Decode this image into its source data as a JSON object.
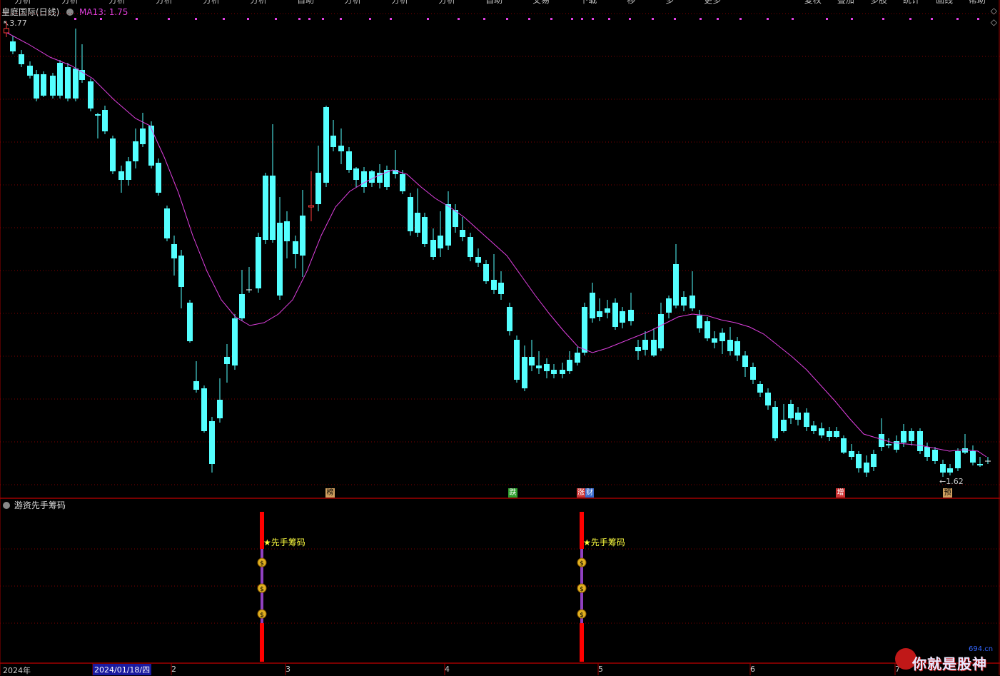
{
  "window": {
    "title": "皇庭国际(日线)",
    "ma_label": "MA13: 1.75",
    "high_label": "3.77",
    "low_label": "1.62",
    "indicator_title": "游资先手筹码"
  },
  "top_menu": [
    {
      "label": "分析"
    },
    {
      "label": "分析"
    },
    {
      "label": "分析"
    },
    {
      "label": "分析"
    },
    {
      "label": "分析"
    },
    {
      "label": "分析"
    },
    {
      "label": "自助"
    },
    {
      "label": "分析"
    },
    {
      "label": "分析"
    },
    {
      "label": "分析"
    },
    {
      "label": "自助"
    },
    {
      "label": "交易"
    },
    {
      "label": "下载"
    },
    {
      "label": "移"
    },
    {
      "label": "多"
    },
    {
      "label": "更多"
    }
  ],
  "top_buttons": [
    {
      "label": "复权"
    },
    {
      "label": "叠加"
    },
    {
      "label": "多股"
    },
    {
      "label": "统计"
    },
    {
      "label": "画线"
    },
    {
      "label": "帮助"
    }
  ],
  "events": [
    {
      "label": "榜",
      "color": "#cfa060"
    },
    {
      "label": "跌",
      "color": "#2fa02f"
    },
    {
      "label": "涨",
      "color": "#cc3333"
    },
    {
      "label": "财",
      "color": "#3366cc"
    },
    {
      "label": "增",
      "color": "#cc3333"
    },
    {
      "label": "预",
      "color": "#cfa060"
    }
  ],
  "signals": [
    {
      "label": "★先手筹码"
    },
    {
      "label": "★先手筹码"
    }
  ],
  "axis": {
    "year_label": "2024年",
    "current_date": "2024/01/18/四",
    "months": [
      {
        "label": "2"
      },
      {
        "label": "3"
      },
      {
        "label": "4"
      },
      {
        "label": "5"
      },
      {
        "label": "6"
      },
      {
        "label": "7"
      }
    ]
  },
  "watermark": {
    "text": "你就是股神",
    "site": "694.cn"
  },
  "colors": {
    "up": "#ff3c3c",
    "down": "#54ffff",
    "ma": "#e040e0",
    "signal": "#ff0000",
    "grid": "#800000"
  },
  "chart_data": {
    "type": "candlestick",
    "symbol": "皇庭国际",
    "period": "日线",
    "ma13": 1.75,
    "max_price": 3.77,
    "min_price": 1.62
  }
}
